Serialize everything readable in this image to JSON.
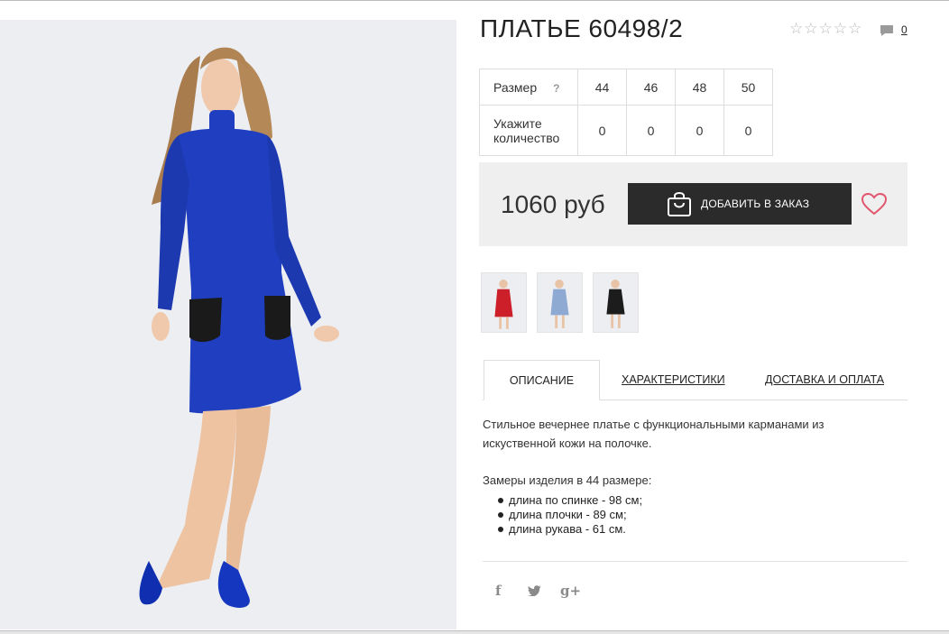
{
  "product": {
    "title": "ПЛАТЬЕ 60498/2",
    "rating_stars": "☆☆☆☆☆",
    "comments_count": "0"
  },
  "sizes": {
    "size_label": "Размер",
    "help_mark": "?",
    "quantity_label": "Укажите количество",
    "values": [
      "44",
      "46",
      "48",
      "50"
    ],
    "quantities": [
      "0",
      "0",
      "0",
      "0"
    ]
  },
  "buy": {
    "price": "1060 руб",
    "add_label": "ДОБАВИТЬ В ЗАКАЗ"
  },
  "colors": {
    "dress_main": "#1f3fc0",
    "button": "#2b2b2b",
    "heart": "#e0566e",
    "thumbs": [
      "#cc1f2a",
      "#8faad2",
      "#1c1c1c"
    ]
  },
  "tabs": [
    {
      "label": "ОПИСАНИЕ",
      "active": true
    },
    {
      "label": "ХАРАКТЕРИСТИКИ",
      "active": false
    },
    {
      "label": "ДОСТАВКА И ОПЛАТА",
      "active": false
    }
  ],
  "description": {
    "text": "Стильное вечернее платье с функциональными карманами из искуственной кожи на полочке.",
    "measures_title": "Замеры изделия в 44 размере:",
    "measures": [
      "длина по спинке - 98 см;",
      "длина плочки - 89 см;",
      "длина рукава - 61 см."
    ]
  },
  "social": {
    "facebook": "f",
    "twitter": "🐦",
    "gplus": "g+"
  }
}
